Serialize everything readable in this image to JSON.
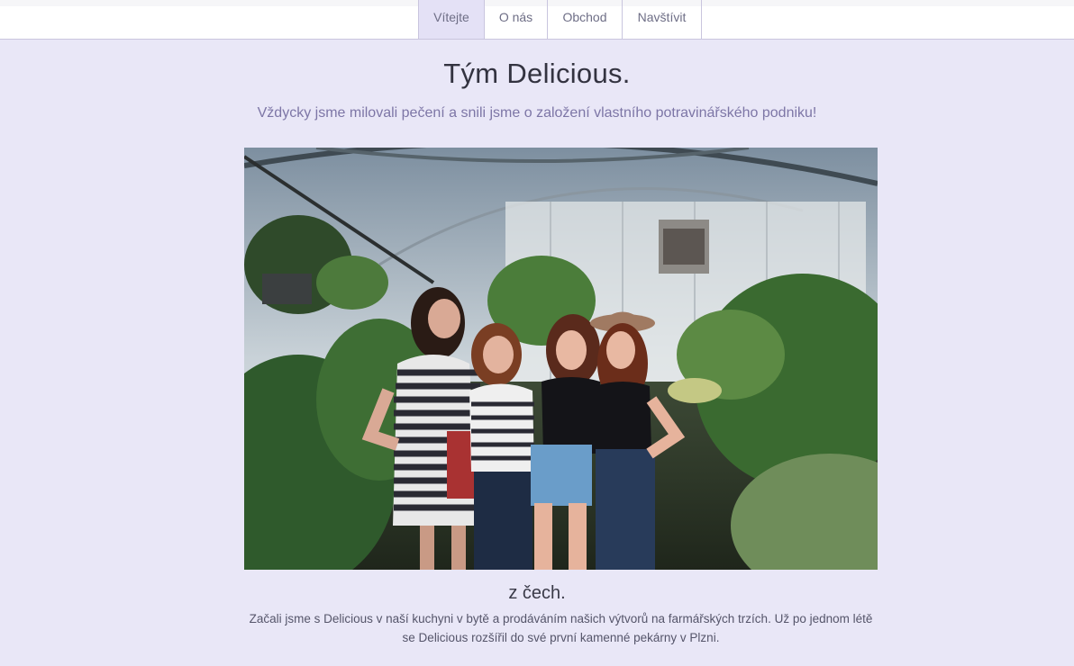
{
  "nav": {
    "items": [
      {
        "label": "Vítejte",
        "active": true
      },
      {
        "label": "O nás",
        "active": false
      },
      {
        "label": "Obchod",
        "active": false
      },
      {
        "label": "Navštívit",
        "active": false
      }
    ]
  },
  "hero": {
    "title": "Tým Delicious.",
    "subtitle": "Vždycky jsme milovali pečení a snili jsme o založení vlastního potravinářského podniku!"
  },
  "story": {
    "heading": "z čech.",
    "text": "Začali jsme s Delicious v naší kuchyni v bytě a prodáváním našich výtvorů na farmářských trzích. Už po jednom létě se Delicious rozšířil do své první kamenné pekárny v Plzni."
  },
  "colors": {
    "background": "#e9e7f7",
    "nav_active": "#e4e1f6",
    "subtitle": "#7d76a6"
  }
}
